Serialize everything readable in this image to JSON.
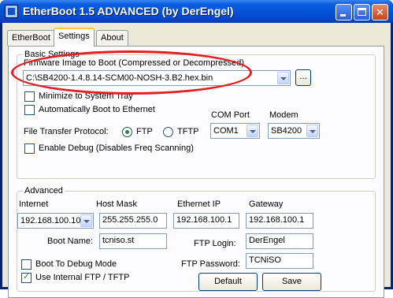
{
  "window": {
    "title": "EtherBoot 1.5 ADVANCED (by DerEngel)"
  },
  "tabs": [
    {
      "label": "EtherBoot"
    },
    {
      "label": "Settings"
    },
    {
      "label": "About"
    }
  ],
  "basic_settings": {
    "title": "Basic Settings",
    "firmware_label": "Firmware Image to Boot (Compressed or Decompressed)",
    "firmware_value": "C:\\SB4200-1.4.8.14-SCM00-NOSH-3.B2.hex.bin",
    "browse_label": "...",
    "minimize_label": "Minimize to System Tray",
    "minimize_checked": false,
    "auto_boot_label": "Automatically Boot to Ethernet",
    "auto_boot_checked": false,
    "com_port_label": "COM Port",
    "com_port_value": "COM1",
    "modem_label": "Modem",
    "modem_value": "SB4200",
    "protocol_label": "File Transfer Protocol:",
    "ftp_label": "FTP",
    "tftp_label": "TFTP",
    "selected_protocol": "FTP",
    "debug_label": "Enable Debug (Disables Freq Scanning)",
    "debug_checked": false
  },
  "advanced": {
    "title": "Advanced",
    "internet_label": "Internet",
    "internet_value": "192.168.100.10",
    "host_mask_label": "Host Mask",
    "host_mask_value": "255.255.255.0",
    "ethernet_ip_label": "Ethernet IP",
    "ethernet_ip_value": "192.168.100.1",
    "gateway_label": "Gateway",
    "gateway_value": "192.168.100.1",
    "boot_name_label": "Boot Name:",
    "boot_name_value": "tcniso.st",
    "ftp_login_label": "FTP Login:",
    "ftp_login_value": "DerEngel",
    "ftp_password_label": "FTP Password:",
    "ftp_password_value": "TCNiSO",
    "debug_mode_label": "Boot To Debug Mode",
    "debug_mode_checked": false,
    "internal_ftp_label": "Use Internal FTP / TFTP",
    "internal_ftp_checked": true,
    "default_button": "Default",
    "save_button": "Save"
  },
  "annotation_color": "#e02020"
}
